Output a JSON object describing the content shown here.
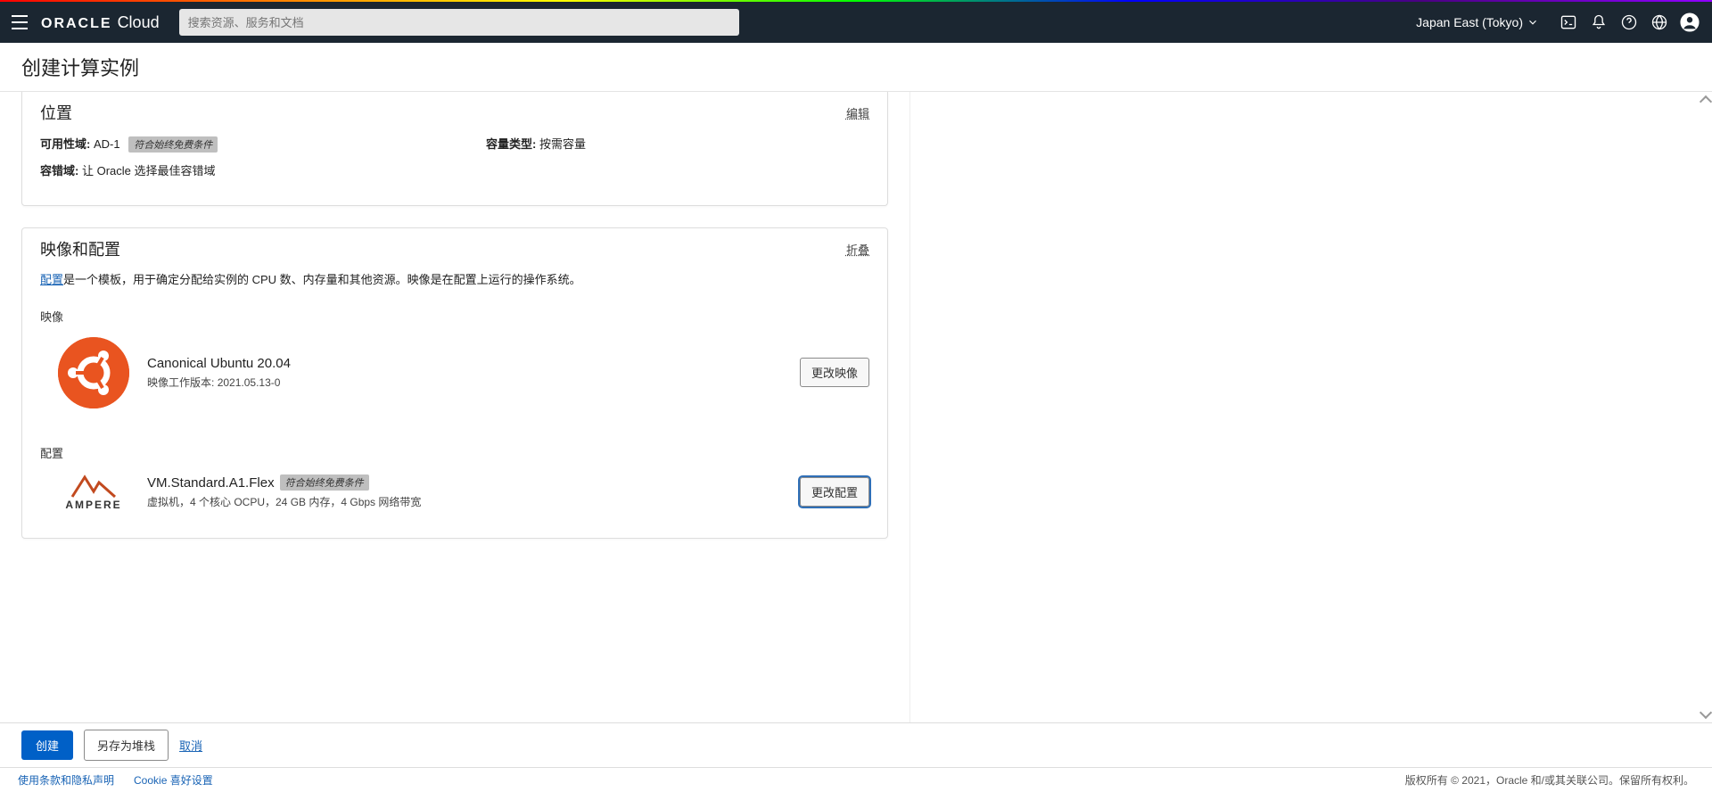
{
  "header": {
    "logo_brand": "ORACLE",
    "logo_product": "Cloud",
    "search_placeholder": "搜索资源、服务和文档",
    "region": "Japan East (Tokyo)"
  },
  "page_title": "创建计算实例",
  "location_panel": {
    "title": "位置",
    "edit": "编辑",
    "ad_label": "可用性域:",
    "ad_value": "AD-1",
    "ad_badge": "符合始终免费条件",
    "fault_label": "容错域:",
    "fault_value": "让 Oracle 选择最佳容错域",
    "capacity_label": "容量类型:",
    "capacity_value": "按需容量"
  },
  "image_panel": {
    "title": "映像和配置",
    "collapse": "折叠",
    "desc_link": "配置",
    "desc_rest": "是一个模板，用于确定分配给实例的 CPU 数、内存量和其他资源。映像是在配置上运行的操作系统。",
    "image_label": "映像",
    "image_name": "Canonical Ubuntu 20.04",
    "image_build_label": "映像工作版本:",
    "image_build_value": "2021.05.13-0",
    "change_image_btn": "更改映像",
    "shape_label": "配置",
    "shape_name": "VM.Standard.A1.Flex",
    "shape_badge": "符合始终免费条件",
    "shape_desc": "虚拟机，4 个核心 OCPU，24 GB 内存，4 Gbps 网络带宽",
    "change_shape_btn": "更改配置"
  },
  "actions": {
    "create": "创建",
    "save_stack": "另存为堆栈",
    "cancel": "取消"
  },
  "footer": {
    "terms": "使用条款和隐私声明",
    "cookies": "Cookie 喜好设置",
    "copyright": "版权所有 © 2021，Oracle 和/或其关联公司。保留所有权利。"
  }
}
